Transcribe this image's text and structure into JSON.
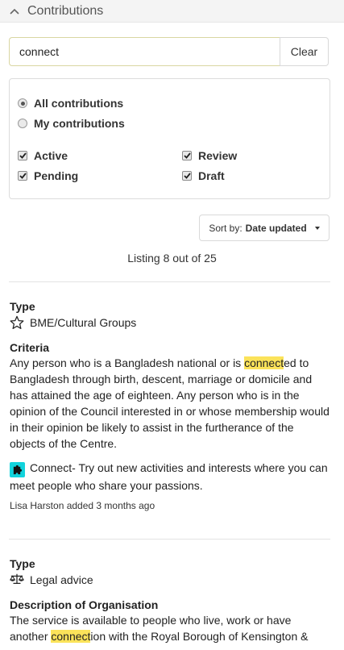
{
  "panel": {
    "title": "Contributions"
  },
  "search": {
    "value": "connect",
    "clear_label": "Clear"
  },
  "filters": {
    "scope": [
      {
        "label": "All contributions",
        "selected": true
      },
      {
        "label": "My contributions",
        "selected": false
      }
    ],
    "status": [
      {
        "label": "Active",
        "checked": true
      },
      {
        "label": "Review",
        "checked": true
      },
      {
        "label": "Pending",
        "checked": true
      },
      {
        "label": "Draft",
        "checked": true
      }
    ]
  },
  "sort": {
    "prefix": "Sort by:",
    "value": "Date updated"
  },
  "listing": {
    "text": "Listing 8 out of 25"
  },
  "cards": [
    {
      "type_label": "Type",
      "type_value": "BME/Cultural Groups",
      "type_icon": "star-outline-icon",
      "section_label": "Criteria",
      "text_before": "Any person who is a Bangladesh national or is ",
      "highlight": "connect",
      "text_after": "ed to Bangladesh through birth, descent, marriage or domicile and has attained the age of eighteen. Any person who is in the opinion of the Council interested in or whose membership would in their opinion be likely to assist in the furtherance of the objects of the Centre.",
      "tag_icon": "puzzle-piece-icon",
      "tag_text": "Connect- Try out new activities and interests where you can meet people who share your passions.",
      "author_line": "Lisa Harston added 3 months ago"
    },
    {
      "type_label": "Type",
      "type_value": "Legal advice",
      "type_icon": "scales-icon",
      "section_label": "Description of Organisation",
      "text_before": "The service is available to people who live, work or have another ",
      "highlight": "connect",
      "text_after": "ion with the Royal Borough of Kensington &"
    }
  ],
  "colors": {
    "highlight": "#fbe35a",
    "tag": "#12d3dc"
  }
}
